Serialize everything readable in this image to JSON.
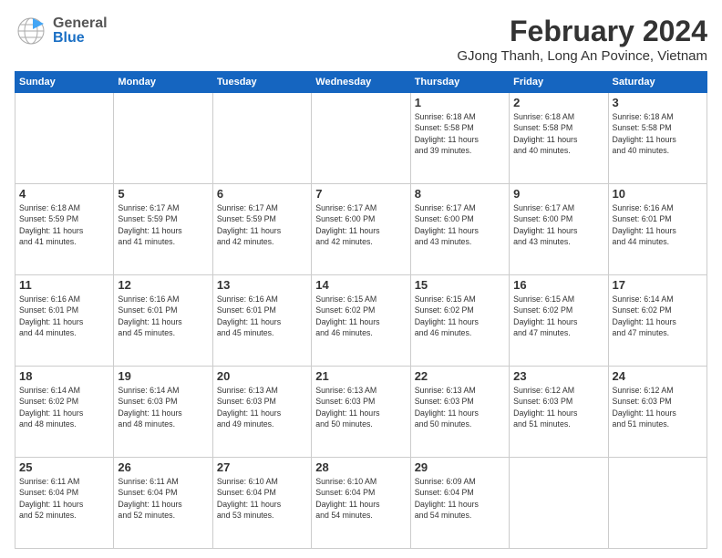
{
  "header": {
    "logo_general": "General",
    "logo_blue": "Blue",
    "title": "February 2024",
    "subtitle": "GJong Thanh, Long An Povince, Vietnam"
  },
  "calendar": {
    "days_of_week": [
      "Sunday",
      "Monday",
      "Tuesday",
      "Wednesday",
      "Thursday",
      "Friday",
      "Saturday"
    ],
    "weeks": [
      [
        {
          "num": "",
          "info": ""
        },
        {
          "num": "",
          "info": ""
        },
        {
          "num": "",
          "info": ""
        },
        {
          "num": "",
          "info": ""
        },
        {
          "num": "1",
          "info": "Sunrise: 6:18 AM\nSunset: 5:58 PM\nDaylight: 11 hours\nand 39 minutes."
        },
        {
          "num": "2",
          "info": "Sunrise: 6:18 AM\nSunset: 5:58 PM\nDaylight: 11 hours\nand 40 minutes."
        },
        {
          "num": "3",
          "info": "Sunrise: 6:18 AM\nSunset: 5:58 PM\nDaylight: 11 hours\nand 40 minutes."
        }
      ],
      [
        {
          "num": "4",
          "info": "Sunrise: 6:18 AM\nSunset: 5:59 PM\nDaylight: 11 hours\nand 41 minutes."
        },
        {
          "num": "5",
          "info": "Sunrise: 6:17 AM\nSunset: 5:59 PM\nDaylight: 11 hours\nand 41 minutes."
        },
        {
          "num": "6",
          "info": "Sunrise: 6:17 AM\nSunset: 5:59 PM\nDaylight: 11 hours\nand 42 minutes."
        },
        {
          "num": "7",
          "info": "Sunrise: 6:17 AM\nSunset: 6:00 PM\nDaylight: 11 hours\nand 42 minutes."
        },
        {
          "num": "8",
          "info": "Sunrise: 6:17 AM\nSunset: 6:00 PM\nDaylight: 11 hours\nand 43 minutes."
        },
        {
          "num": "9",
          "info": "Sunrise: 6:17 AM\nSunset: 6:00 PM\nDaylight: 11 hours\nand 43 minutes."
        },
        {
          "num": "10",
          "info": "Sunrise: 6:16 AM\nSunset: 6:01 PM\nDaylight: 11 hours\nand 44 minutes."
        }
      ],
      [
        {
          "num": "11",
          "info": "Sunrise: 6:16 AM\nSunset: 6:01 PM\nDaylight: 11 hours\nand 44 minutes."
        },
        {
          "num": "12",
          "info": "Sunrise: 6:16 AM\nSunset: 6:01 PM\nDaylight: 11 hours\nand 45 minutes."
        },
        {
          "num": "13",
          "info": "Sunrise: 6:16 AM\nSunset: 6:01 PM\nDaylight: 11 hours\nand 45 minutes."
        },
        {
          "num": "14",
          "info": "Sunrise: 6:15 AM\nSunset: 6:02 PM\nDaylight: 11 hours\nand 46 minutes."
        },
        {
          "num": "15",
          "info": "Sunrise: 6:15 AM\nSunset: 6:02 PM\nDaylight: 11 hours\nand 46 minutes."
        },
        {
          "num": "16",
          "info": "Sunrise: 6:15 AM\nSunset: 6:02 PM\nDaylight: 11 hours\nand 47 minutes."
        },
        {
          "num": "17",
          "info": "Sunrise: 6:14 AM\nSunset: 6:02 PM\nDaylight: 11 hours\nand 47 minutes."
        }
      ],
      [
        {
          "num": "18",
          "info": "Sunrise: 6:14 AM\nSunset: 6:02 PM\nDaylight: 11 hours\nand 48 minutes."
        },
        {
          "num": "19",
          "info": "Sunrise: 6:14 AM\nSunset: 6:03 PM\nDaylight: 11 hours\nand 48 minutes."
        },
        {
          "num": "20",
          "info": "Sunrise: 6:13 AM\nSunset: 6:03 PM\nDaylight: 11 hours\nand 49 minutes."
        },
        {
          "num": "21",
          "info": "Sunrise: 6:13 AM\nSunset: 6:03 PM\nDaylight: 11 hours\nand 50 minutes."
        },
        {
          "num": "22",
          "info": "Sunrise: 6:13 AM\nSunset: 6:03 PM\nDaylight: 11 hours\nand 50 minutes."
        },
        {
          "num": "23",
          "info": "Sunrise: 6:12 AM\nSunset: 6:03 PM\nDaylight: 11 hours\nand 51 minutes."
        },
        {
          "num": "24",
          "info": "Sunrise: 6:12 AM\nSunset: 6:03 PM\nDaylight: 11 hours\nand 51 minutes."
        }
      ],
      [
        {
          "num": "25",
          "info": "Sunrise: 6:11 AM\nSunset: 6:04 PM\nDaylight: 11 hours\nand 52 minutes."
        },
        {
          "num": "26",
          "info": "Sunrise: 6:11 AM\nSunset: 6:04 PM\nDaylight: 11 hours\nand 52 minutes."
        },
        {
          "num": "27",
          "info": "Sunrise: 6:10 AM\nSunset: 6:04 PM\nDaylight: 11 hours\nand 53 minutes."
        },
        {
          "num": "28",
          "info": "Sunrise: 6:10 AM\nSunset: 6:04 PM\nDaylight: 11 hours\nand 54 minutes."
        },
        {
          "num": "29",
          "info": "Sunrise: 6:09 AM\nSunset: 6:04 PM\nDaylight: 11 hours\nand 54 minutes."
        },
        {
          "num": "",
          "info": ""
        },
        {
          "num": "",
          "info": ""
        }
      ]
    ]
  }
}
